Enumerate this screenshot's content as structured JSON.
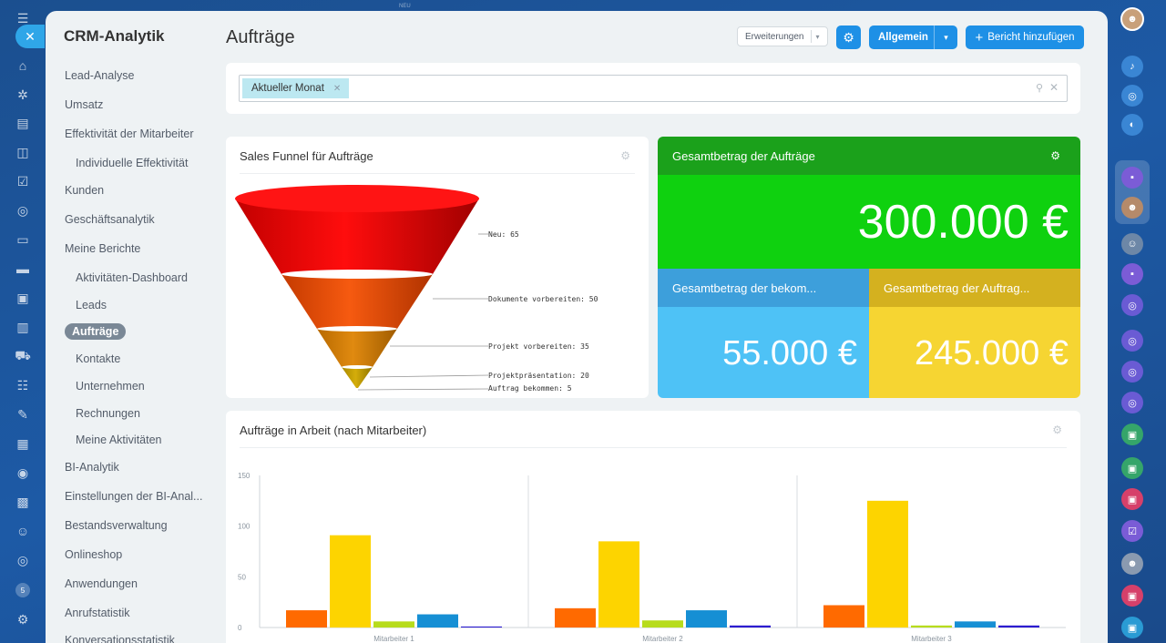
{
  "topbar": {
    "badge": "NEU"
  },
  "sidebar": {
    "title": "CRM-Analytik",
    "items": [
      {
        "label": "Lead-Analyse",
        "level": "top"
      },
      {
        "label": "Umsatz",
        "level": "top"
      },
      {
        "label": "Effektivität der Mitarbeiter",
        "level": "top"
      },
      {
        "label": "Individuelle Effektivität",
        "level": "sub"
      },
      {
        "label": "Kunden",
        "level": "top"
      },
      {
        "label": "Geschäftsanalytik",
        "level": "top"
      },
      {
        "label": "Meine Berichte",
        "level": "top"
      },
      {
        "label": "Aktivitäten-Dashboard",
        "level": "sub"
      },
      {
        "label": "Leads",
        "level": "sub"
      },
      {
        "label": "Aufträge",
        "level": "active"
      },
      {
        "label": "Kontakte",
        "level": "sub"
      },
      {
        "label": "Unternehmen",
        "level": "sub"
      },
      {
        "label": "Rechnungen",
        "level": "sub"
      },
      {
        "label": "Meine Aktivitäten",
        "level": "sub"
      },
      {
        "label": "BI-Analytik",
        "level": "top"
      },
      {
        "label": "Einstellungen der BI-Anal...",
        "level": "top"
      },
      {
        "label": "Bestandsverwaltung",
        "level": "top"
      },
      {
        "label": "Onlineshop",
        "level": "top"
      },
      {
        "label": "Anwendungen",
        "level": "top"
      },
      {
        "label": "Anrufstatistik",
        "level": "top"
      },
      {
        "label": "Konversationsstatistik",
        "level": "top"
      }
    ]
  },
  "header": {
    "title": "Aufträge",
    "extensions_label": "Erweiterungen",
    "general_label": "Allgemein",
    "add_report_label": "Bericht hinzufügen"
  },
  "filter": {
    "chip_label": "Aktueller Monat"
  },
  "funnel": {
    "title": "Sales Funnel für Aufträge",
    "stages": [
      {
        "label": "Neu: 65",
        "value": 65
      },
      {
        "label": "Dokumente vorbereiten: 50",
        "value": 50
      },
      {
        "label": "Projekt vorbereiten: 35",
        "value": 35
      },
      {
        "label": "Projektpräsentation: 20",
        "value": 20
      },
      {
        "label": "Auftrag bekommen: 5",
        "value": 5
      }
    ]
  },
  "totals": {
    "main_title": "Gesamtbetrag der Aufträge",
    "main_value": "300.000 €",
    "received_title": "Gesamtbetrag der bekom...",
    "received_value": "55.000 €",
    "orders_title": "Gesamtbetrag der Auftrag...",
    "orders_value": "245.000 €"
  },
  "colors": {
    "accent": "#1e90e6",
    "total_head": "#1ba11b",
    "total_body": "#0fd10f",
    "received_head": "#3d9fdb",
    "received_body": "#4ec2f6",
    "orders_head": "#d4b11f",
    "orders_body": "#f6d532"
  },
  "chart_data": {
    "type": "bar",
    "title": "Aufträge in Arbeit (nach Mitarbeiter)",
    "categories": [
      "Mitarbeiter 1",
      "Mitarbeiter 2",
      "Mitarbeiter 3"
    ],
    "series": [
      {
        "color": "#ff6a00",
        "values": [
          17,
          19,
          22
        ]
      },
      {
        "color": "#fdd400",
        "values": [
          91,
          85,
          125
        ]
      },
      {
        "color": "#b7dc1d",
        "values": [
          6,
          7,
          2
        ]
      },
      {
        "color": "#168fd4",
        "values": [
          13,
          17,
          6
        ]
      },
      {
        "color": "#2c1ccf",
        "values": [
          1,
          2,
          2
        ]
      }
    ],
    "ylim": [
      0,
      150
    ],
    "yticks": [
      "0",
      "50",
      "100",
      "150"
    ],
    "grid": false
  },
  "rightrail": {
    "icons": [
      "bell-icon",
      "target-icon",
      "chat-icon",
      "app-icon",
      "avatar-icon",
      "group-icon",
      "app-icon",
      "target-icon",
      "target-icon",
      "target-icon",
      "target-icon",
      "lock-icon",
      "lock-icon",
      "lock-icon",
      "checkbox-icon",
      "avatar-icon",
      "lock-icon",
      "lock-icon"
    ]
  },
  "leftrail": {
    "badge": "5"
  }
}
